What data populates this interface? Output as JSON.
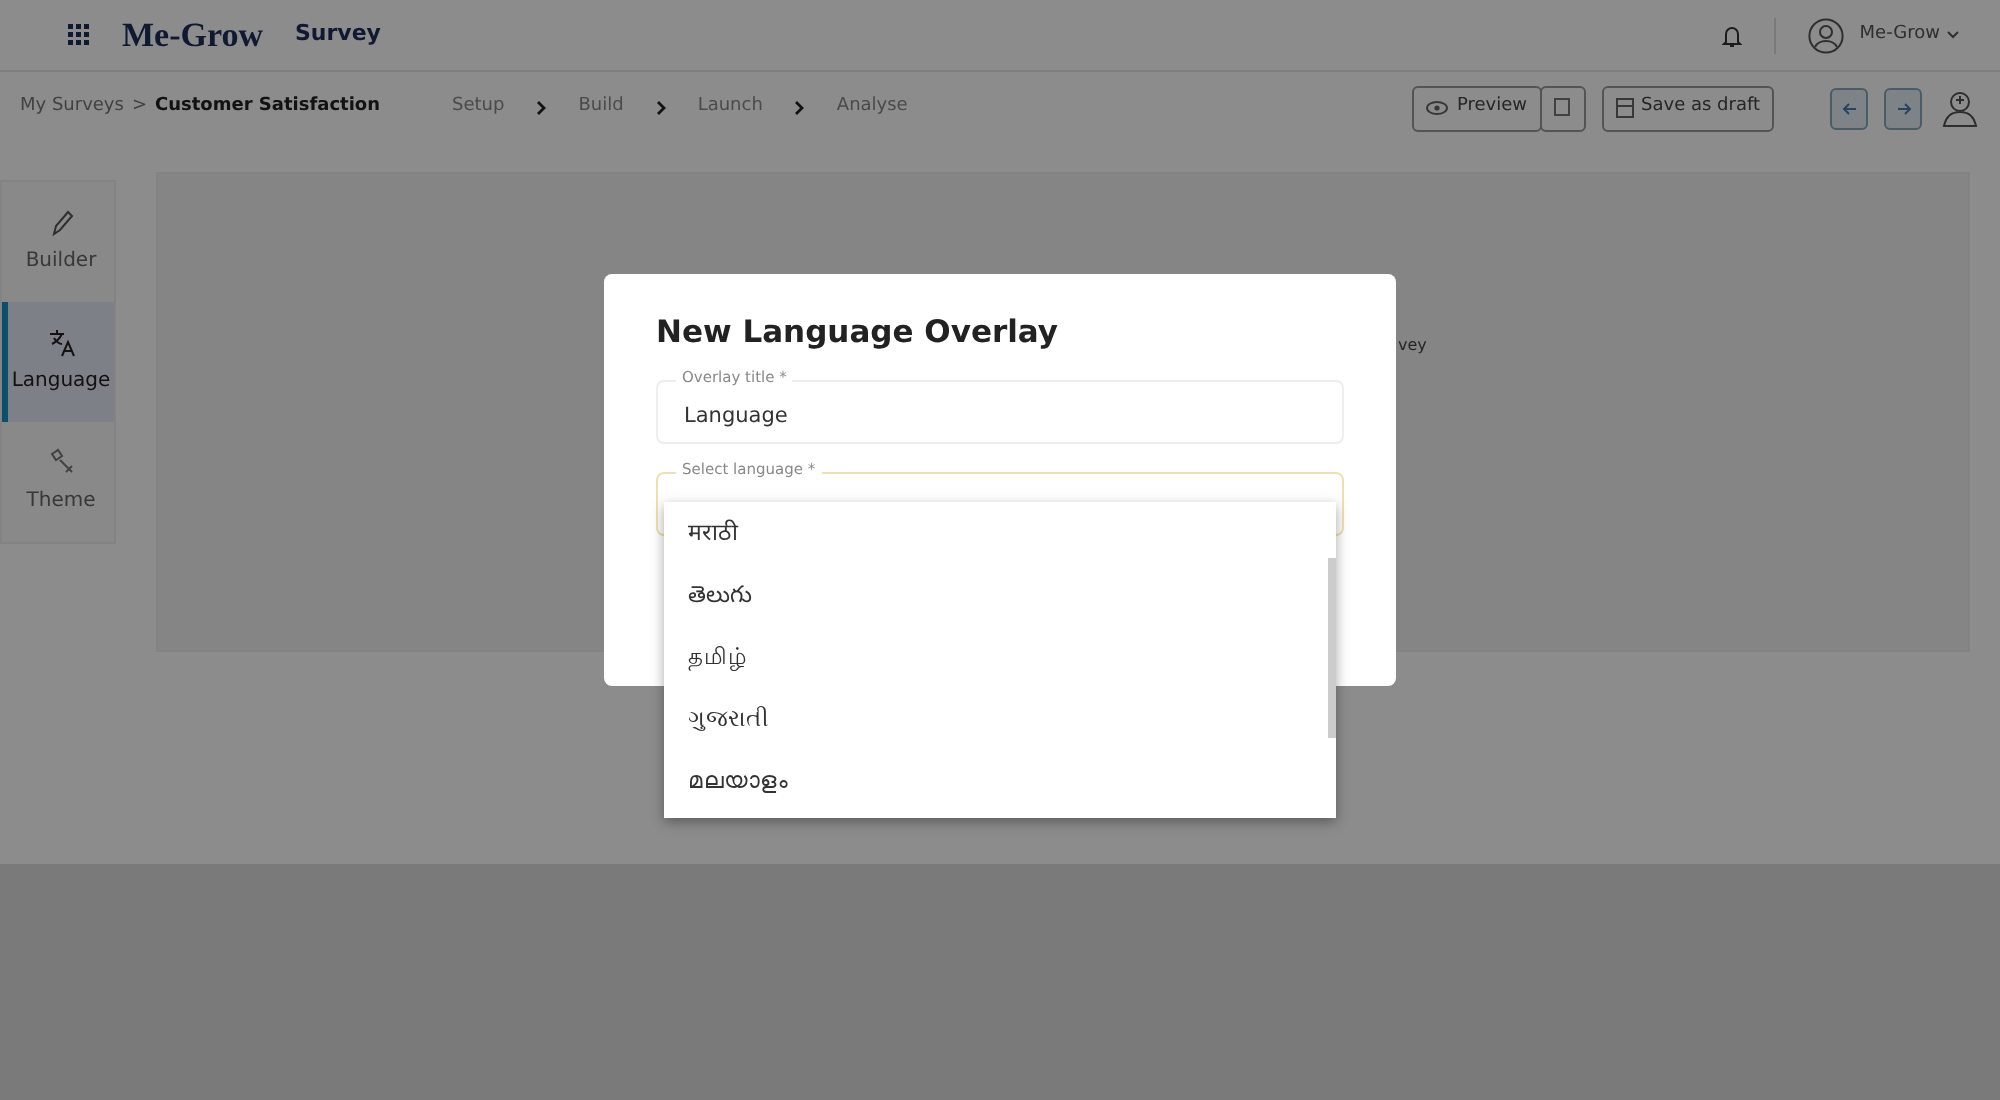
{
  "header": {
    "logo": "Me-Grow",
    "app": "Survey",
    "user": "Me-Grow"
  },
  "toolbar": {
    "separator": ">",
    "breadcrumb": [
      {
        "label": "My Surveys",
        "current": false
      },
      {
        "label": "Customer Satisfaction",
        "current": true
      }
    ],
    "steps": [
      "Setup",
      "Build",
      "Launch",
      "Analyse"
    ],
    "buttons": [
      {
        "kind": "preview",
        "label": "Preview"
      },
      {
        "kind": "copy"
      },
      {
        "kind": "draft",
        "label": "Save as draft"
      },
      {
        "kind": "back"
      },
      {
        "kind": "forward"
      },
      {
        "kind": "profile"
      }
    ]
  },
  "sidebar": {
    "items": [
      {
        "kind": "builder",
        "label": "Builder",
        "selected": false
      },
      {
        "kind": "language",
        "label": "Language",
        "selected": true
      },
      {
        "kind": "theme",
        "label": "Theme",
        "selected": false
      }
    ]
  },
  "content": {
    "fragment": "vey"
  },
  "modal": {
    "title": "New Language Overlay",
    "fields": [
      {
        "label": "Overlay title *",
        "value": "Language",
        "focused": false
      },
      {
        "label": "Select language *",
        "focused": true
      }
    ]
  },
  "dropdown": {
    "options": [
      "मराठी",
      "తెలుగు",
      "தமிழ்",
      "ગુજરાતી",
      "മലയാളം"
    ]
  }
}
